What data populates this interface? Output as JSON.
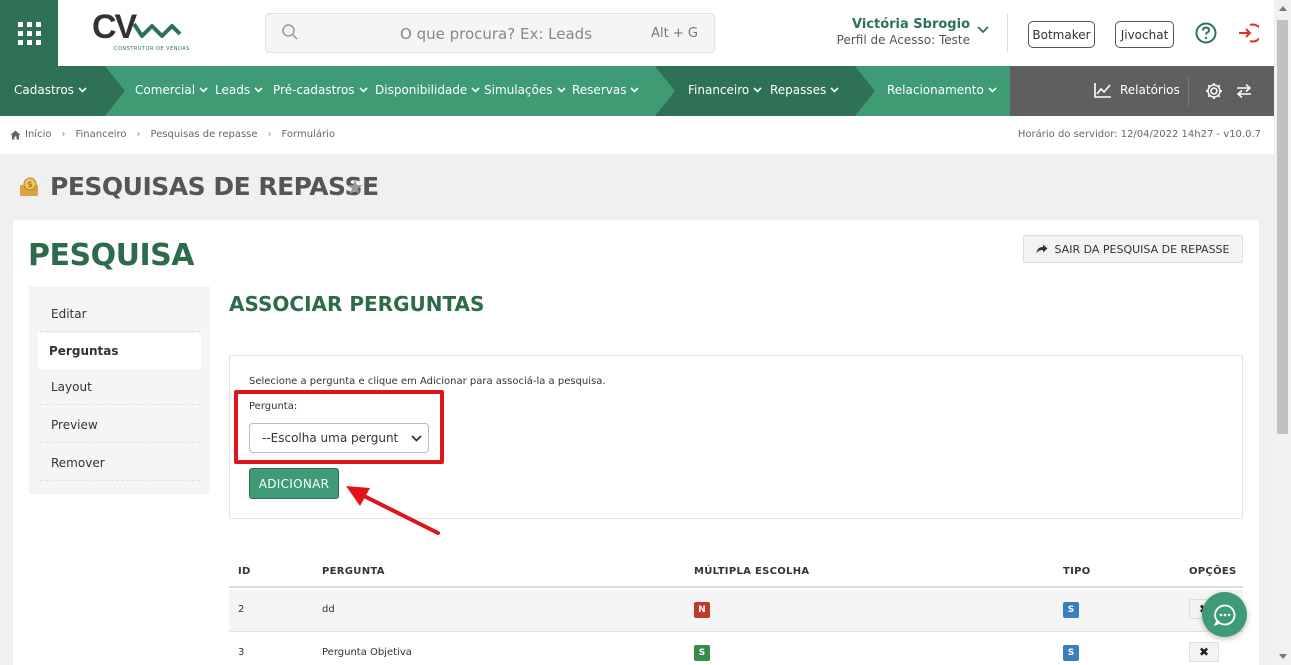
{
  "header": {
    "logo_text": "CV",
    "logo_subtitle": "CONSTRUTOR DE VENDAS",
    "search_placeholder": "O que procura? Ex: Leads",
    "search_shortcut": "Alt + G",
    "user_name": "Victória Sbrogio",
    "user_profile": "Perfil de Acesso: Teste",
    "botmaker_label": "Botmaker",
    "jivochat_label": "Jivochat"
  },
  "nav": {
    "items": [
      {
        "label": "Cadastros"
      },
      {
        "label": "Comercial"
      },
      {
        "label": "Leads"
      },
      {
        "label": "Pré-cadastros"
      },
      {
        "label": "Disponibilidade"
      },
      {
        "label": "Simulações"
      },
      {
        "label": "Reservas"
      },
      {
        "label": "Financeiro"
      },
      {
        "label": "Repasses"
      },
      {
        "label": "Relacionamento"
      }
    ],
    "reports_label": "Relatórios"
  },
  "breadcrumb": {
    "items": [
      "Início",
      "Financeiro",
      "Pesquisas de repasse",
      "Formulário"
    ],
    "server_time": "Horário do servidor: 12/04/2022 14h27 - v10.0.7"
  },
  "page": {
    "title": "PESQUISAS DE REPASSE",
    "card_title": "PESQUISA",
    "exit_label": "SAIR DA PESQUISA DE REPASSE"
  },
  "sidebar": {
    "items": [
      {
        "label": "Editar"
      },
      {
        "label": "Perguntas"
      },
      {
        "label": "Layout"
      },
      {
        "label": "Preview"
      },
      {
        "label": "Remover"
      }
    ],
    "active": "Perguntas"
  },
  "form": {
    "section_title": "ASSOCIAR PERGUNTAS",
    "help_text": "Selecione a pergunta e clique em Adicionar para associá-la a pesquisa.",
    "question_label": "Pergunta:",
    "select_value": "--Escolha uma pergunt",
    "add_label": "ADICIONAR"
  },
  "table": {
    "headers": [
      "ID",
      "PERGUNTA",
      "MÚLTIPLA ESCOLHA",
      "TIPO",
      "OPÇÕES"
    ],
    "rows": [
      {
        "id": "2",
        "question": "dd",
        "multiple": "N",
        "type": "S"
      },
      {
        "id": "3",
        "question": "Pergunta Objetiva",
        "multiple": "S",
        "type": "S"
      }
    ]
  },
  "colors": {
    "brand_green": "#2e7154",
    "nav_green": "#3e9b74",
    "badge_red": "#c0392b",
    "badge_green": "#3c8a4a",
    "badge_blue": "#3a7ebf",
    "highlight_red": "#e0151b"
  }
}
